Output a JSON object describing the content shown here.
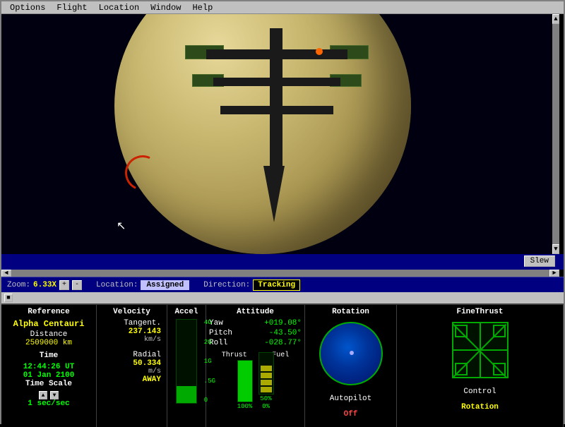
{
  "menubar": {
    "items": [
      "Options",
      "Flight",
      "Location",
      "Window",
      "Help"
    ]
  },
  "viewport": {
    "cursor_visible": true
  },
  "slew": {
    "label": "Slew"
  },
  "zoombar": {
    "zoom_label": "Zoom:",
    "zoom_value": "6.33X",
    "zoom_plus": "+",
    "zoom_minus": "-",
    "location_label": "Location:",
    "location_value": "Assigned",
    "direction_label": "Direction:",
    "direction_value": "Tracking"
  },
  "instruments": {
    "reference": {
      "title": "Reference",
      "name": "Alpha Centauri",
      "distance_label": "Distance",
      "distance_value": "2509000 km"
    },
    "time": {
      "title": "Time",
      "value": "12:44:26 UT",
      "date": "01 Jan 2100",
      "scale_label": "Time Scale",
      "scale_value": "1 sec/sec"
    },
    "velocity": {
      "title": "Velocity",
      "tangent_label": "Tangent.",
      "tangent_value": "237.143",
      "tangent_unit": "km/s",
      "radial_label": "Radial",
      "radial_value": "50.334",
      "radial_unit": "m/s",
      "direction": "AWAY"
    },
    "accel": {
      "title": "Accel",
      "labels": [
        "4G",
        "2G",
        "1G",
        ".5G",
        "0"
      ],
      "fill_pct": 20
    },
    "attitude": {
      "title": "Attitude",
      "yaw_label": "Yaw",
      "yaw_value": "+019.08°",
      "pitch_label": "Pitch",
      "pitch_value": "-43.50°",
      "roll_label": "Roll",
      "roll_value": "-028.77°",
      "thrust_label": "Thrust",
      "fuel_label": "Fuel",
      "thrust_pct": "100%",
      "fuel_50pct": "50%",
      "fuel_0pct": "0%"
    },
    "rotation": {
      "title": "Rotation",
      "autopilot_label": "Autopilot",
      "autopilot_value": "Off"
    },
    "finethrust": {
      "title": "FineThrust",
      "control_label": "Control",
      "control_value": "Rotation"
    }
  }
}
